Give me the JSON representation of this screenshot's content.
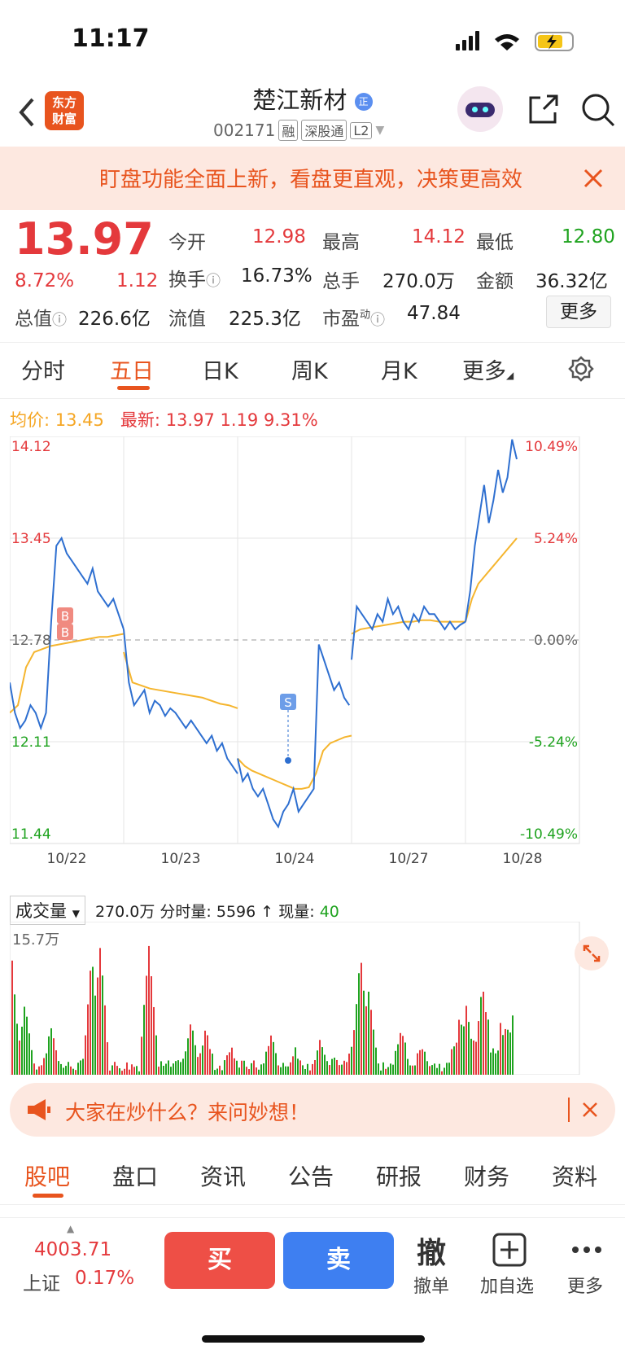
{
  "status": {
    "time": "11:17"
  },
  "header": {
    "logo_line1": "东方",
    "logo_line2": "财富",
    "title": "楚江新材",
    "code": "002171",
    "tags": [
      "融",
      "深股通",
      "L2"
    ]
  },
  "banner": {
    "text": "盯盘功能全面上新，看盘更直观，决策更高效"
  },
  "quote": {
    "price": "13.97",
    "pct": "8.72%",
    "change": "1.12",
    "open_label": "今开",
    "open": "12.98",
    "high_label": "最高",
    "high": "14.12",
    "low_label": "最低",
    "low": "12.80",
    "turnover_label": "换手",
    "turnover": "16.73%",
    "volume_label": "总手",
    "volume": "270.0万",
    "amount_label": "金额",
    "amount": "36.32亿",
    "mcap_label": "总值",
    "mcap": "226.6亿",
    "float_label": "流值",
    "float": "225.3亿",
    "pe_label": "市盈",
    "pe_sup": "动",
    "pe": "47.84",
    "more": "更多"
  },
  "tabs": [
    "分时",
    "五日",
    "日K",
    "周K",
    "月K",
    "更多"
  ],
  "legend": {
    "avg_label": "均价:",
    "avg": "13.45",
    "latest_label": "最新:",
    "latest": "13.97",
    "chg": "1.19",
    "pct": "9.31%"
  },
  "colors": {
    "up": "#e4393c",
    "down": "#1fa31f",
    "price_line": "#2e6fd0",
    "avg_line": "#f5b52e",
    "accent": "#e8541e"
  },
  "chart_data": {
    "type": "line",
    "x": [
      "10/22",
      "10/23",
      "10/24",
      "10/27",
      "10/28"
    ],
    "y_left": [
      "14.12",
      "13.45",
      "12.78",
      "12.11",
      "11.44"
    ],
    "y_right": [
      "10.49%",
      "5.24%",
      "0.00%",
      "-5.24%",
      "-10.49%"
    ],
    "ylim": [
      11.44,
      14.12
    ],
    "prev_close": 12.78,
    "series": [
      {
        "day": 0,
        "price": [
          12.5,
          12.3,
          12.2,
          12.25,
          12.35,
          12.3,
          12.2,
          12.3,
          12.9,
          13.4,
          13.45,
          13.35,
          13.3,
          13.25,
          13.2,
          13.15,
          13.25,
          13.1,
          13.05,
          13.0,
          13.05,
          12.95,
          12.85
        ],
        "avg": [
          12.3,
          12.35,
          12.6,
          12.7,
          12.72,
          12.74,
          12.75,
          12.76,
          12.77,
          12.78,
          12.79,
          12.8,
          12.8,
          12.81,
          12.82
        ]
      },
      {
        "day": 1,
        "price": [
          12.85,
          12.5,
          12.35,
          12.4,
          12.45,
          12.3,
          12.38,
          12.35,
          12.28,
          12.33,
          12.3,
          12.25,
          12.2,
          12.25,
          12.2,
          12.15,
          12.1,
          12.15,
          12.05,
          12.1,
          12.0,
          11.95,
          11.9
        ],
        "avg": [
          12.7,
          12.5,
          12.48,
          12.46,
          12.45,
          12.44,
          12.43,
          12.42,
          12.41,
          12.4,
          12.38,
          12.36,
          12.35,
          12.33
        ]
      },
      {
        "day": 2,
        "price": [
          12.0,
          11.85,
          11.9,
          11.8,
          11.75,
          11.8,
          11.7,
          11.6,
          11.55,
          11.65,
          11.7,
          11.8,
          11.65,
          11.7,
          11.75,
          11.8,
          12.75,
          12.65,
          12.55,
          12.45,
          12.5,
          12.4,
          12.35
        ],
        "avg": [
          12.0,
          11.95,
          11.92,
          11.9,
          11.88,
          11.86,
          11.84,
          11.82,
          11.8,
          11.8,
          11.81,
          11.9,
          12.05,
          12.1,
          12.12,
          12.14,
          12.15
        ]
      },
      {
        "day": 3,
        "price": [
          12.65,
          13.0,
          12.95,
          12.9,
          12.85,
          12.95,
          12.9,
          13.05,
          12.95,
          13.0,
          12.9,
          12.85,
          12.95,
          12.9,
          13.0,
          12.95,
          12.95,
          12.9,
          12.85,
          12.9,
          12.85,
          12.88,
          12.9
        ],
        "avg": [
          12.82,
          12.85,
          12.86,
          12.87,
          12.88,
          12.89,
          12.9,
          12.9,
          12.91,
          12.91,
          12.9,
          12.9,
          12.9,
          12.9
        ]
      },
      {
        "day": 4,
        "price": [
          12.9,
          13.1,
          13.4,
          13.6,
          13.8,
          13.55,
          13.7,
          13.9,
          13.75,
          13.85,
          14.1,
          13.97
        ],
        "avg": [
          12.9,
          13.05,
          13.15,
          13.2,
          13.25,
          13.3,
          13.35,
          13.4,
          13.45
        ]
      }
    ]
  },
  "volume": {
    "label": "成交量",
    "total": "270.0万",
    "tick_label": "分时量:",
    "tick": "5596 ↑",
    "now_label": "现量:",
    "now": "40",
    "max": "15.7万"
  },
  "promo": {
    "text": "大家在炒什么？来问妙想！"
  },
  "bottom_tabs": [
    "股吧",
    "盘口",
    "资讯",
    "公告",
    "研报",
    "财务",
    "资料"
  ],
  "bottom_bar": {
    "index_value": "4003.71",
    "index_name": "上证",
    "index_pct": "0.17%",
    "buy": "买",
    "sell": "卖",
    "cancel_icon": "撤",
    "cancel": "撤单",
    "add": "加自选",
    "more": "更多"
  }
}
